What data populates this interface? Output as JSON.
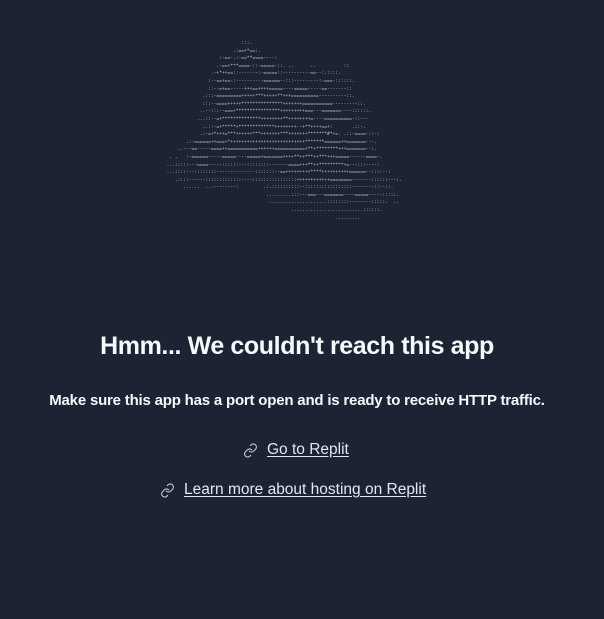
{
  "ascii_art": {
    "lines": [
      "                                 :::.",
      "                              .:==+*==:.",
      "                         :-==-.:-==**====----:",
      "                        .-==+***====-::-=====-::. ..      ..          ::",
      "                      .-+*++==::-------:-=====::----------==--:.::::.",
      "                     :--==+==-:----------======--:::---------:-===-::::::.",
      "                     ::--=+==-----+++==++++=====----=====-----==-------::",
      "                   .:::-=========+++++***+++++**+++==========----------::.",
      "                   :::--====+++++***************+++++++===========---------::.",
      "                  ..--:::--===+****************+++++++++===---=======----::::::.",
      "                 ...::--=+**************++++++++**++++++++=----==========-::---",
      "                   ..::-=+*****+*************++++++++--+**++++==+:       .::-.",
      "                  .:-=+*+++=***++++++***+++++++***+++++++*******#*+=. .::-====-::-:",
      "             .:-======++===+*+++++++++++++++++++++++++++*******======++=======---.",
      "          ..---==-----====++===========++++++===========+**+********+++=======--:.",
      "       . .   :-======-----=====----=====+=======++++**++***++***+++=====------====-.",
      "      ...:::::---====-----::::::---::::::::-------====+++**++*********+=---:::----:",
      "      ...::::---::::::::--------------:::::::--==+++++++++****++++++++++======--::::--:",
      "         .::::------:::::::::::::----::::::::::::::::++++++++++++========-------::::::---:.",
      "            ......  ...--------:         .:.::::::::::--:::::::::::::::::--------::--::.",
      "                                          .........:::---===---=======----=====-----:::::.",
      "                                           .....................::::::::--------:::::.  ..",
      "                                                   ..........................::::::.",
      "                                                                   ........."
    ]
  },
  "title": "Hmm... We couldn't reach this app",
  "subtitle": "Make sure this app has a port open and is ready to receive HTTP traffic.",
  "links": {
    "replit": {
      "label": "Go to Replit",
      "icon": "link-icon"
    },
    "hosting": {
      "label": "Learn more about hosting on Replit",
      "icon": "link-icon"
    }
  },
  "colors": {
    "background": "#1c2333",
    "text": "#f5f9fc",
    "link": "#e4e8ee"
  }
}
